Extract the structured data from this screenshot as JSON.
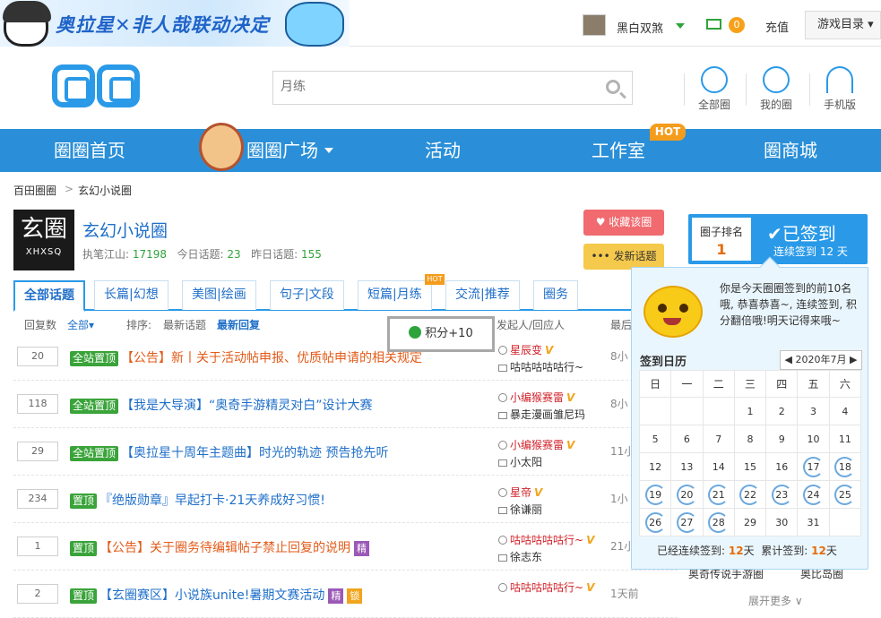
{
  "banner": {
    "text": "奥拉星✕非人哉联动决定"
  },
  "header": {
    "username": "黑白双煞",
    "mail_count": "0",
    "recharge": "充值",
    "game_dir": "游戏目录"
  },
  "search": {
    "placeholder": "月练"
  },
  "top_icons": [
    {
      "label": "全部圈"
    },
    {
      "label": "我的圈"
    },
    {
      "label": "手机版"
    }
  ],
  "nav": [
    {
      "label": "圈圈首页"
    },
    {
      "label": "圈圈广场"
    },
    {
      "label": "活动"
    },
    {
      "label": "工作室"
    },
    {
      "label": "圈商城"
    }
  ],
  "nav_hot": "HOT",
  "breadcrumb": [
    "百田圈圈",
    "玄幻小说圈"
  ],
  "group": {
    "logo_big": "玄圈",
    "logo_small": "XHXSQ",
    "name": "玄幻小说圈",
    "owner_label": "执笔江山:",
    "owner_value": "17198",
    "today_label": "今日话题:",
    "today_value": "23",
    "yesterday_label": "昨日话题:",
    "yesterday_value": "155",
    "fav_button": "收藏该圈",
    "post_button": "发新话题"
  },
  "rank": {
    "label": "圈子排名",
    "value": "1",
    "signed": "已签到",
    "streak": "连续签到 12 天"
  },
  "tabs": [
    {
      "label": "全部话题"
    },
    {
      "label": "长篇|幻想"
    },
    {
      "label": "美图|绘画"
    },
    {
      "label": "句子|文段"
    },
    {
      "label": "短篇|月练"
    },
    {
      "label": "交流|推荐"
    },
    {
      "label": "圈务"
    }
  ],
  "tab_hot": "HOT",
  "filter": {
    "reply_label": "回复数",
    "all": "全部",
    "sort_label": "排序:",
    "latest_topic": "最新话题",
    "latest_reply": "最新回复",
    "author_col": "发起人/回应人",
    "time_col": "最后"
  },
  "points_toast": "积分+10",
  "topics": [
    {
      "count": "20",
      "tags": [
        "全站置顶"
      ],
      "title": "【公告】新丨关于活动帖申报、优质帖申请的相关规定",
      "orange": true,
      "jing": false,
      "suo": false,
      "author": "星辰变",
      "replier": "咕咕咕咕咕行~",
      "time": "8小"
    },
    {
      "count": "118",
      "tags": [
        "全站置顶"
      ],
      "title": "【我是大导演】“奥奇手游精灵对白”设计大赛",
      "orange": false,
      "jing": false,
      "suo": false,
      "author": "小编猴赛雷",
      "replier": "暴走漫画雏尼玛",
      "time": "8小"
    },
    {
      "count": "29",
      "tags": [
        "全站置顶"
      ],
      "title": "【奥拉星十周年主题曲】时光的轨迹 预告抢先听",
      "orange": false,
      "jing": false,
      "suo": false,
      "author": "小编猴赛雷",
      "replier": "小太阳",
      "time": "11小"
    },
    {
      "count": "234",
      "tags": [
        "置顶"
      ],
      "title": "『绝版勋章』早起打卡·21天养成好习惯!",
      "orange": false,
      "jing": false,
      "suo": false,
      "author": "星帝",
      "replier": "徐谦丽",
      "time": "1小"
    },
    {
      "count": "1",
      "tags": [
        "置顶"
      ],
      "title": "【公告】关于圈务待编辑帖子禁止回复的说明",
      "orange": true,
      "jing": true,
      "suo": false,
      "author": "咕咕咕咕咕行~",
      "replier": "徐志东",
      "time": "21小"
    },
    {
      "count": "2",
      "tags": [
        "置顶"
      ],
      "title": "【玄圈赛区】小说族unite!暑期文赛活动",
      "orange": false,
      "jing": true,
      "suo": true,
      "author": "咕咕咕咕咕行~",
      "replier": "",
      "time": "1天前"
    }
  ],
  "badges": {
    "jing": "精",
    "suo": "锁"
  },
  "popup": {
    "message": "你是今天圈圈签到的前10名哦, 恭喜恭喜~, 连续签到, 积分翻倍哦!明天记得来哦~",
    "cal_title": "签到日历",
    "month": "2020年7月",
    "weekdays": [
      "日",
      "一",
      "二",
      "三",
      "四",
      "五",
      "六"
    ],
    "weeks": [
      [
        "",
        "",
        "",
        "1",
        "2",
        "3",
        "4"
      ],
      [
        "5",
        "6",
        "7",
        "8",
        "9",
        "10",
        "11"
      ],
      [
        "12",
        "13",
        "14",
        "15",
        "16",
        "17",
        "18"
      ],
      [
        "19",
        "20",
        "21",
        "22",
        "23",
        "24",
        "25"
      ],
      [
        "26",
        "27",
        "28",
        "29",
        "30",
        "31",
        ""
      ]
    ],
    "checked_days": [
      "17",
      "18",
      "19",
      "20",
      "21",
      "22",
      "23",
      "24",
      "25",
      "26",
      "27",
      "28"
    ],
    "streak_label": "已经连续签到:",
    "streak_value": "12",
    "streak_unit": "天",
    "total_label": "累计签到:",
    "total_value": "12",
    "total_unit": "天"
  },
  "behind": {
    "left": "奥奇传说手游圈",
    "right": "奥比岛圈",
    "more": "展开更多"
  }
}
